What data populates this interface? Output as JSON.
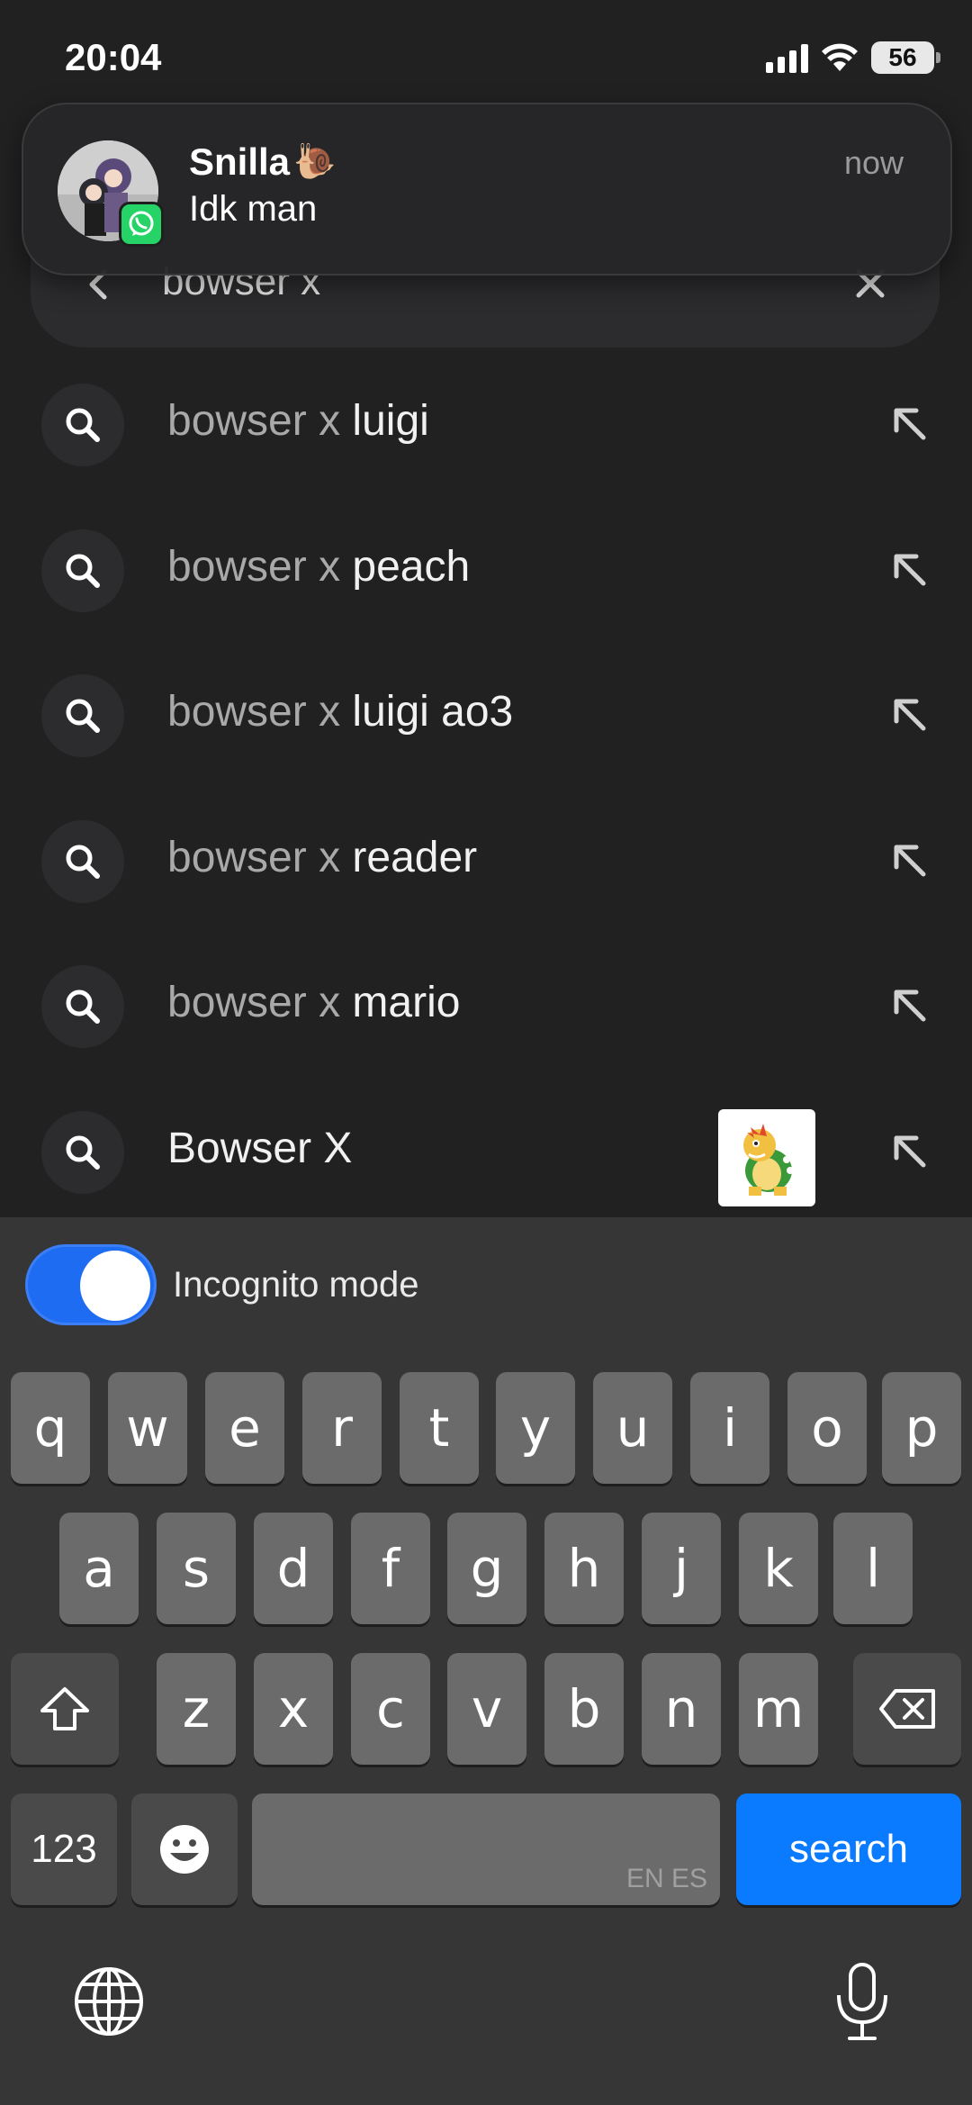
{
  "status_bar": {
    "time": "20:04",
    "battery": "56"
  },
  "search": {
    "query": "bowser x"
  },
  "notification": {
    "title": "Snilla",
    "title_emoji": "🐌",
    "message": "Idk man",
    "time": "now",
    "app_icon": "whatsapp-icon"
  },
  "suggestions": [
    {
      "prefix": "bowser x",
      "rest": " luigi",
      "icon": "search-icon",
      "action_icon": "arrow-up-left-icon"
    },
    {
      "prefix": "bowser x",
      "rest": " peach",
      "icon": "search-icon",
      "action_icon": "arrow-up-left-icon"
    },
    {
      "prefix": "bowser x",
      "rest": " luigi ao3",
      "icon": "search-icon",
      "action_icon": "arrow-up-left-icon"
    },
    {
      "prefix": "bowser x",
      "rest": " reader",
      "icon": "search-icon",
      "action_icon": "arrow-up-left-icon"
    },
    {
      "prefix": "bowser x",
      "rest": " mario",
      "icon": "search-icon",
      "action_icon": "arrow-up-left-icon"
    },
    {
      "prefix": "",
      "rest": "Bowser X",
      "icon": "search-icon",
      "action_icon": "arrow-up-left-icon",
      "thumbnail": "bowser-thumbnail"
    }
  ],
  "keyboard": {
    "incognito_label": "Incognito mode",
    "incognito_enabled": true,
    "row1": [
      "q",
      "w",
      "e",
      "r",
      "t",
      "y",
      "u",
      "i",
      "o",
      "p"
    ],
    "row2": [
      "a",
      "s",
      "d",
      "f",
      "g",
      "h",
      "j",
      "k",
      "l"
    ],
    "row3": [
      "z",
      "x",
      "c",
      "v",
      "b",
      "n",
      "m"
    ],
    "numbers_label": "123",
    "space_hint": "EN ES",
    "search_label": "search"
  },
  "colors": {
    "background": "#212121",
    "keyboard": "#363636",
    "key": "#6b6b6b",
    "accent": "#0a7aff",
    "toggle_on": "#1d6cf2",
    "whatsapp": "#25d366"
  }
}
